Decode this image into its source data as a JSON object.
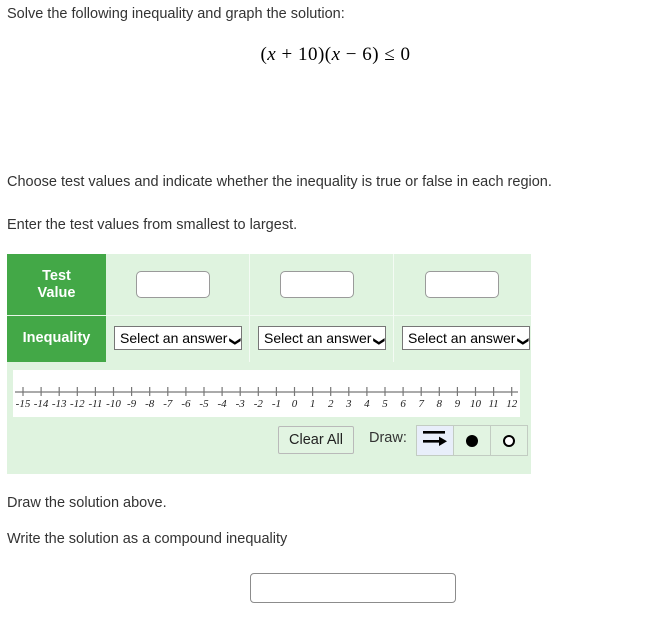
{
  "prompts": {
    "main": "Solve the following inequality and graph the solution:",
    "choose": "Choose test values and indicate whether the inequality is true or false in each region.",
    "enter": "Enter the test values from smallest to largest.",
    "draw_above": "Draw the solution above.",
    "write_solution": "Write the solution as a compound inequality"
  },
  "expression": {
    "left_paren_1": "(",
    "var_1": "x",
    "op_1": "+",
    "num_1": "10",
    "right_paren_1": ")",
    "left_paren_2": "(",
    "var_2": "x",
    "op_2": "−",
    "num_2": "6",
    "right_paren_2": ")",
    "relation": "≤",
    "rhs": "0",
    "full": "(x + 10)(x − 6) ≤ 0"
  },
  "table": {
    "row_headers": {
      "test_value": "Test\nValue",
      "test_value_line1": "Test",
      "test_value_line2": "Value",
      "inequality": "Inequality"
    },
    "test_values": [
      "",
      "",
      ""
    ],
    "test_value_placeholder": "",
    "selects": [
      {
        "value": "Select an answer",
        "chevron": "chevron-down-icon"
      },
      {
        "value": "Select an answer",
        "chevron": "chevron-down-icon"
      },
      {
        "value": "Select an answer",
        "chevron": "chevron-down-icon"
      }
    ],
    "header_bg": "#43a847",
    "panel_bg": "#dff3df"
  },
  "number_line": {
    "min": -15,
    "max": 12,
    "tick_step": 1,
    "labels": [
      "-15",
      "-14",
      "-13",
      "-12",
      "-11",
      "-10",
      "-9",
      "-8",
      "-7",
      "-6",
      "-5",
      "-4",
      "-3",
      "-2",
      "-1",
      "0",
      "1",
      "2",
      "3",
      "4",
      "5",
      "6",
      "7",
      "8",
      "9",
      "10",
      "11",
      "12"
    ],
    "axis_color": "#777777",
    "label_color": "#222222"
  },
  "toolbar": {
    "clear_all_label": "Clear All",
    "draw_label": "Draw:",
    "tools": [
      {
        "name": "ray-tool",
        "icon": "ray-arrow-icon",
        "selected": true
      },
      {
        "name": "closed-point-tool",
        "icon": "filled-dot-icon",
        "selected": false
      },
      {
        "name": "open-point-tool",
        "icon": "open-dot-icon",
        "selected": false
      }
    ],
    "selected_bg": "#e8eefa"
  },
  "answer": {
    "value": "",
    "placeholder": ""
  }
}
